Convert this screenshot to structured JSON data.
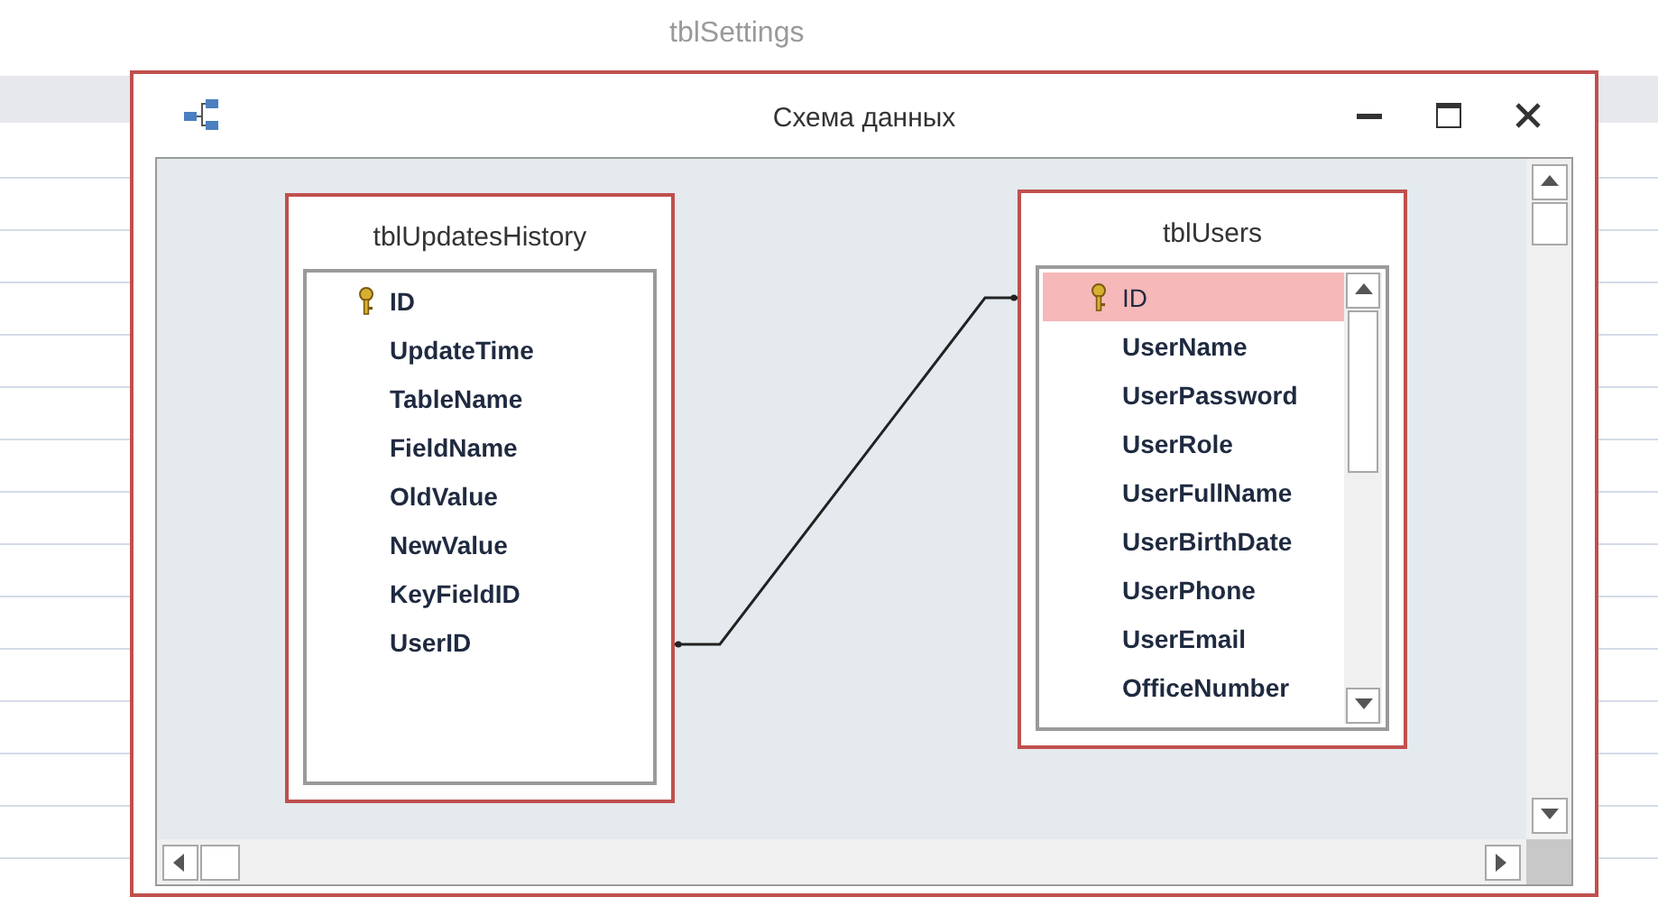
{
  "backdrop": {
    "title": "tblSettings"
  },
  "dialog": {
    "title": "Схема данных"
  },
  "tables": [
    {
      "name": "tblUpdatesHistory",
      "scrollable": false,
      "fields": [
        {
          "name": "ID",
          "key": true,
          "selected": false
        },
        {
          "name": "UpdateTime",
          "key": false,
          "selected": false
        },
        {
          "name": "TableName",
          "key": false,
          "selected": false
        },
        {
          "name": "FieldName",
          "key": false,
          "selected": false
        },
        {
          "name": "OldValue",
          "key": false,
          "selected": false
        },
        {
          "name": "NewValue",
          "key": false,
          "selected": false
        },
        {
          "name": "KeyFieldID",
          "key": false,
          "selected": false
        },
        {
          "name": "UserID",
          "key": false,
          "selected": false
        }
      ]
    },
    {
      "name": "tblUsers",
      "scrollable": true,
      "fields": [
        {
          "name": "ID",
          "key": true,
          "selected": true
        },
        {
          "name": "UserName",
          "key": false,
          "selected": false
        },
        {
          "name": "UserPassword",
          "key": false,
          "selected": false
        },
        {
          "name": "UserRole",
          "key": false,
          "selected": false
        },
        {
          "name": "UserFullName",
          "key": false,
          "selected": false
        },
        {
          "name": "UserBirthDate",
          "key": false,
          "selected": false
        },
        {
          "name": "UserPhone",
          "key": false,
          "selected": false
        },
        {
          "name": "UserEmail",
          "key": false,
          "selected": false
        },
        {
          "name": "OfficeNumber",
          "key": false,
          "selected": false
        }
      ]
    }
  ]
}
